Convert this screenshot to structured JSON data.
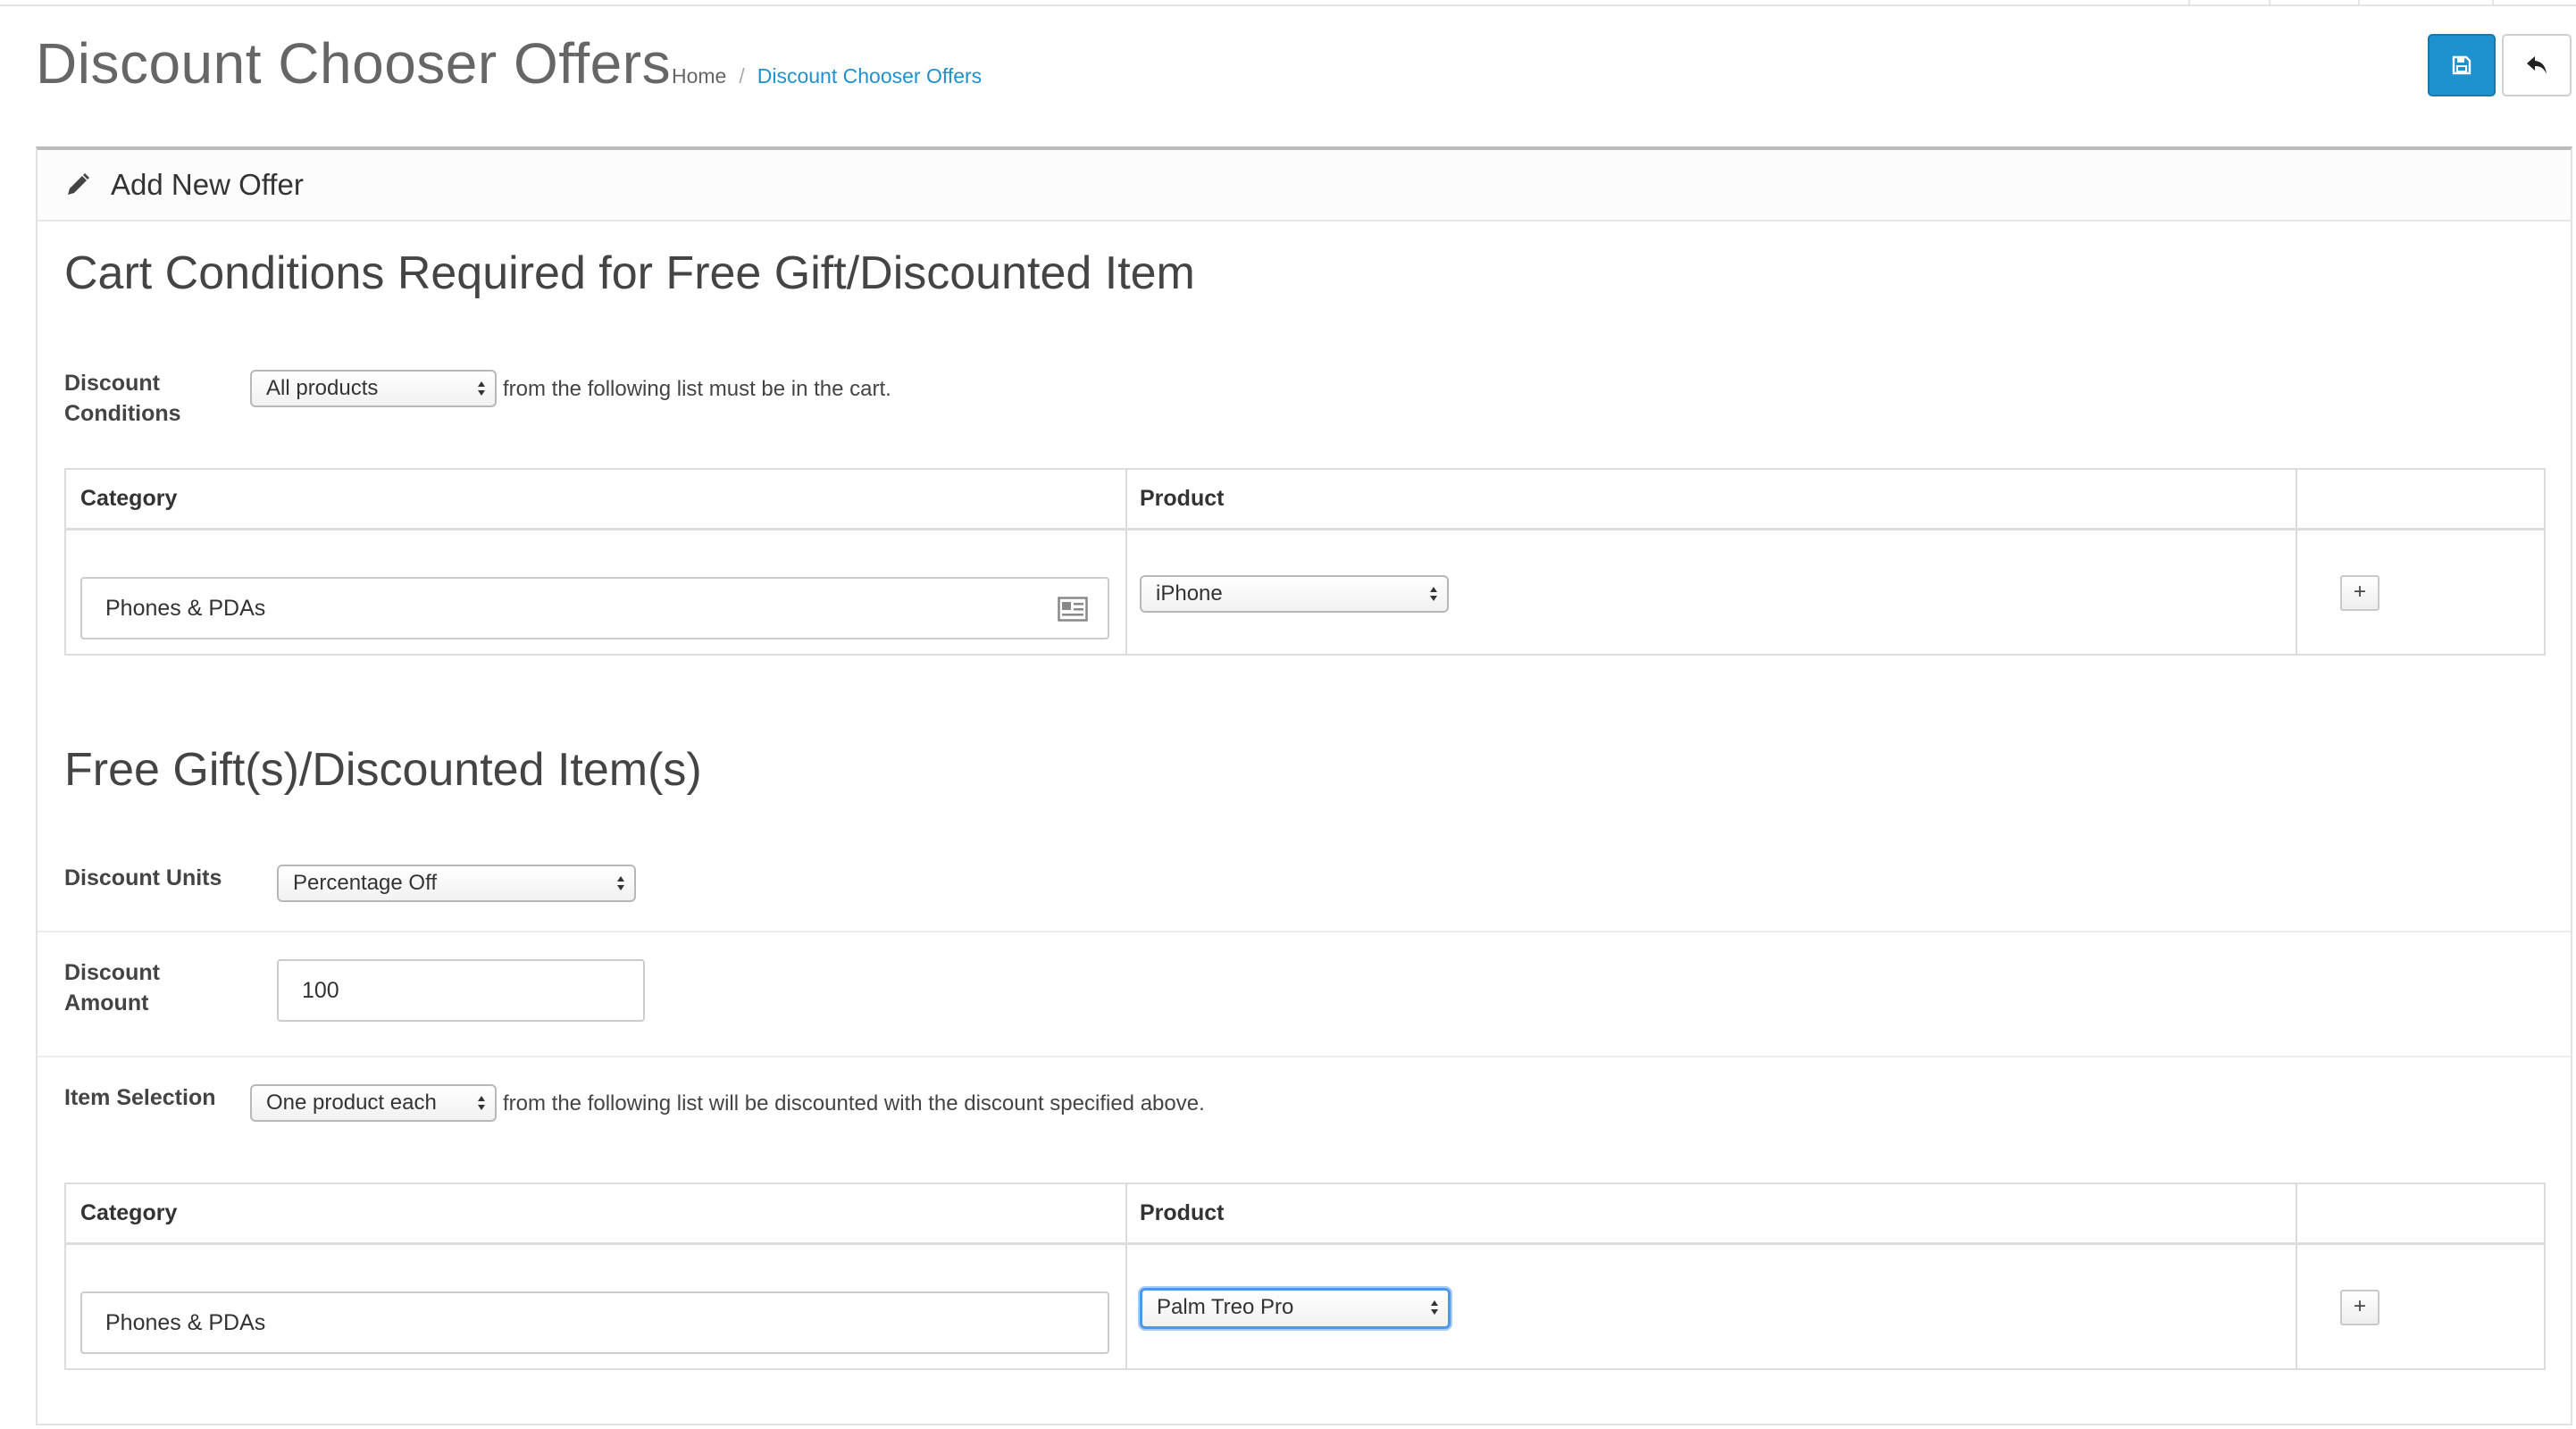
{
  "header": {
    "title": "Discount Chooser Offers",
    "breadcrumb": {
      "home": "Home",
      "separator": "/",
      "current": "Discount Chooser Offers"
    },
    "save_icon": "save-icon",
    "back_icon": "reply-icon"
  },
  "panel": {
    "heading_icon": "pencil-icon",
    "heading": "Add New Offer"
  },
  "cart_conditions": {
    "title": "Cart Conditions Required for Free Gift/Discounted Item",
    "label_line1": "Discount",
    "label_line2": "Conditions",
    "select_value": "All products",
    "suffix": "from the following list must be in the cart.",
    "table": {
      "col_category": "Category",
      "col_product": "Product",
      "row": {
        "category": "Phones & PDAs",
        "product": "iPhone",
        "add_label": "+"
      }
    }
  },
  "free_gift": {
    "title": "Free Gift(s)/Discounted Item(s)",
    "units_label": "Discount Units",
    "units_value": "Percentage Off",
    "amount_label_line1": "Discount",
    "amount_label_line2": "Amount",
    "amount_value": "100",
    "selection_label": "Item Selection",
    "selection_value": "One product each",
    "selection_suffix": "from the following list will be discounted with the discount specified above.",
    "table": {
      "col_category": "Category",
      "col_product": "Product",
      "row": {
        "category": "Phones & PDAs",
        "product": "Palm Treo Pro",
        "add_label": "+"
      }
    }
  },
  "colors": {
    "primary": "#1e91cf",
    "link": "#1e91cf",
    "focus": "#4f95ea"
  }
}
